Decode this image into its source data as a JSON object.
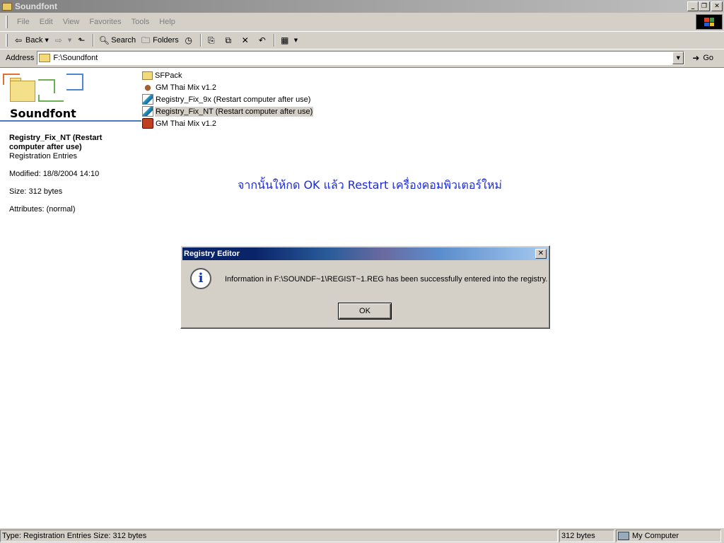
{
  "window": {
    "title": "Soundfont"
  },
  "menu": [
    "File",
    "Edit",
    "View",
    "Favorites",
    "Tools",
    "Help"
  ],
  "toolbar": {
    "back": "Back",
    "search": "Search",
    "folders": "Folders"
  },
  "address": {
    "label": "Address",
    "value": "F:\\Soundfont",
    "go": "Go"
  },
  "leftpane": {
    "folder_name": "Soundfont",
    "selected_name": "Registry_Fix_NT (Restart computer after use)",
    "selected_type": "Registration Entries",
    "modified": "Modified: 18/8/2004 14:10",
    "size": "Size: 312 bytes",
    "attributes": "Attributes: (normal)"
  },
  "files": [
    {
      "name": "SFPack",
      "icon": "folder-icon"
    },
    {
      "name": "GM Thai Mix v1.2",
      "icon": "midi-file-icon"
    },
    {
      "name": "Registry_Fix_9x (Restart computer after use)",
      "icon": "registry-file-icon"
    },
    {
      "name": "Registry_Fix_NT (Restart computer after use)",
      "icon": "registry-file-icon",
      "selected": true
    },
    {
      "name": "GM Thai Mix v1.2",
      "icon": "executable-icon"
    }
  ],
  "annotation": "จากนั้นให้กด OK แล้ว Restart เครื่องคอมพิวเตอร์ใหม่",
  "dialog": {
    "title": "Registry Editor",
    "message": "Information in F:\\SOUNDF~1\\REGIST~1.REG has been successfully entered into the registry.",
    "ok": "OK"
  },
  "statusbar": {
    "main": "Type: Registration Entries Size: 312 bytes",
    "size": "312 bytes",
    "zone": "My Computer"
  }
}
